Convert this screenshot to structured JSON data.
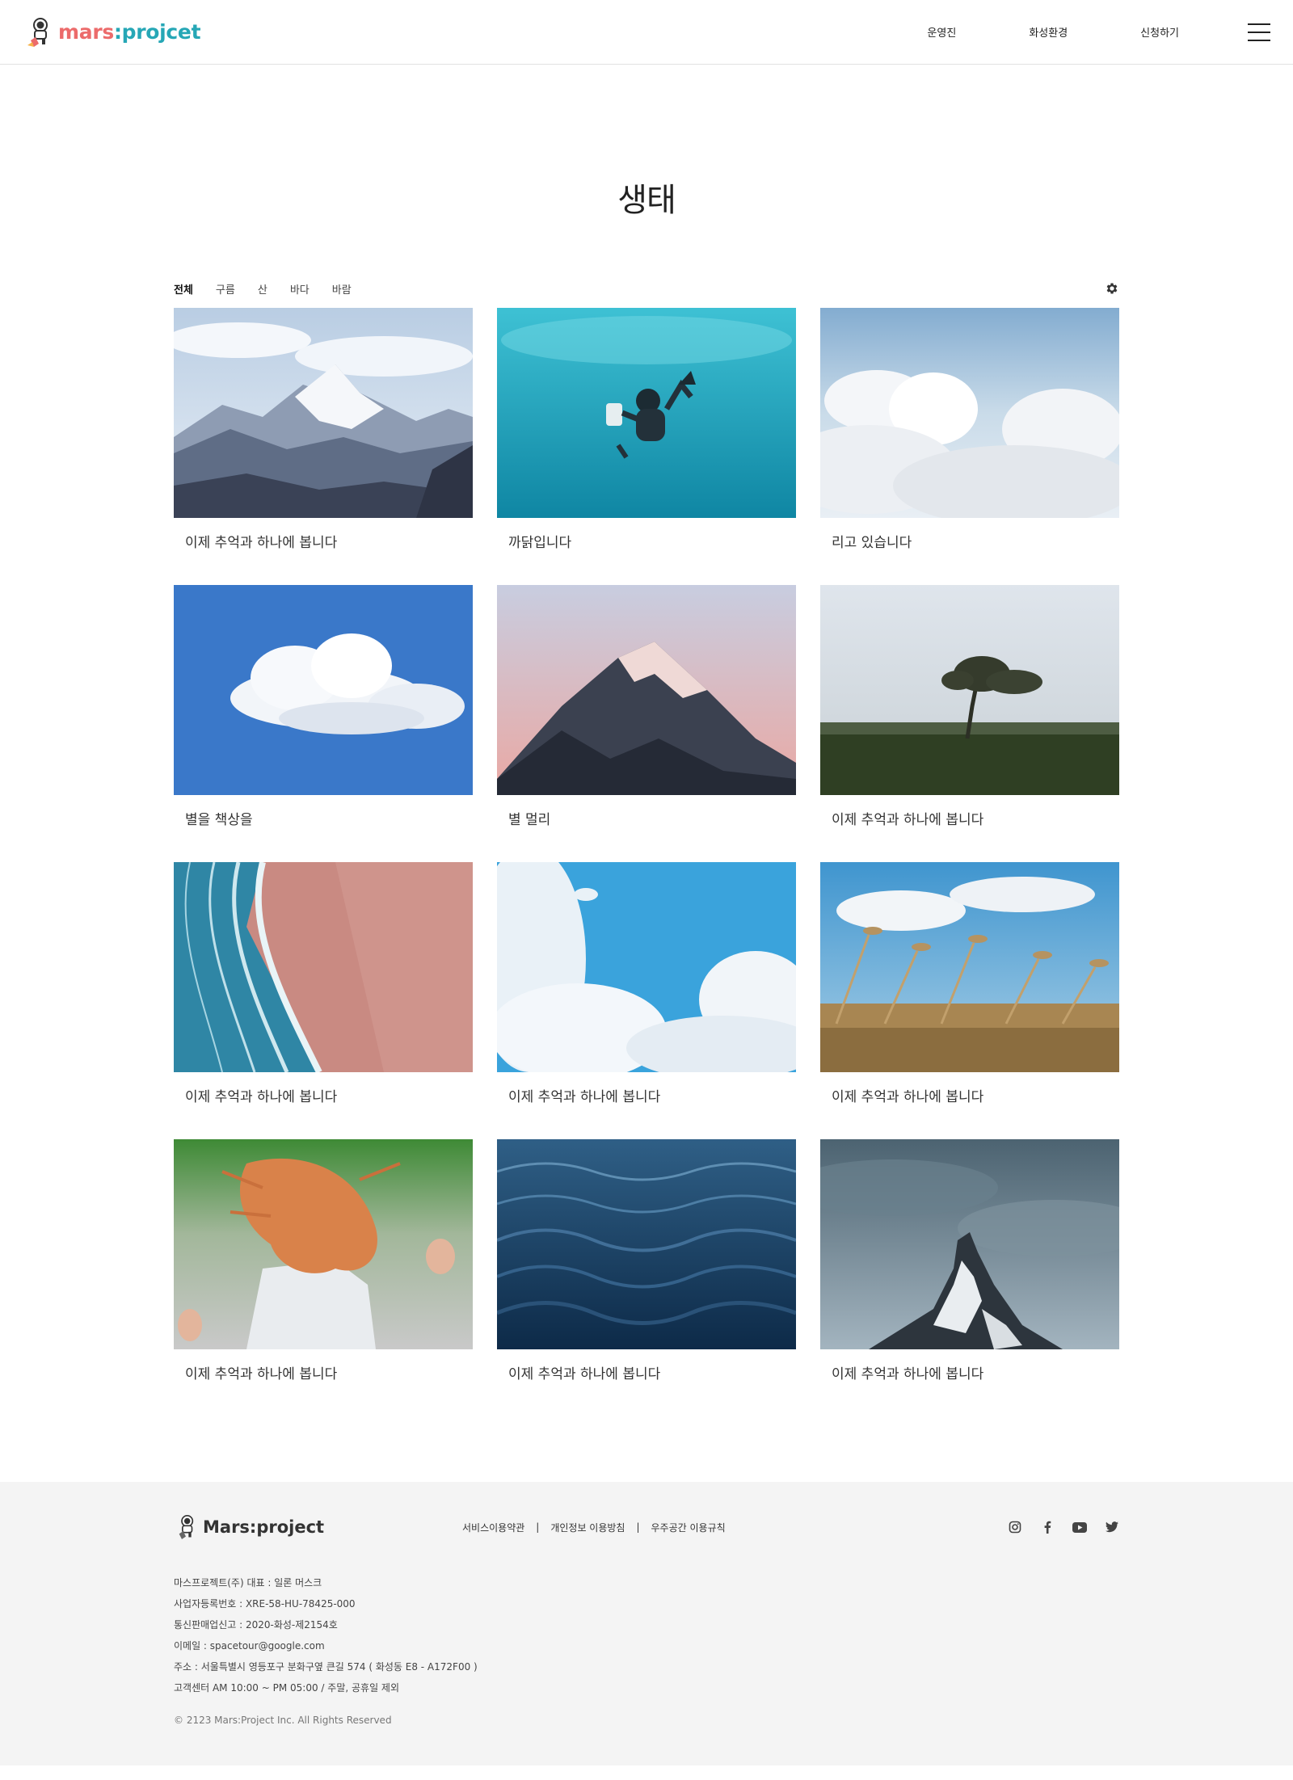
{
  "header": {
    "logo_word1": "mars",
    "logo_word2": ":projcet",
    "nav": [
      "운영진",
      "화성환경",
      "신청하기"
    ]
  },
  "page": {
    "title": "생태",
    "filters": [
      "전체",
      "구름",
      "산",
      "바다",
      "바람"
    ],
    "active_filter": "전체"
  },
  "cards": [
    {
      "image": "snowy-mountain-range",
      "caption": "이제 추억과 하나에 봅니다"
    },
    {
      "image": "underwater-diver",
      "caption": "까닭입니다"
    },
    {
      "image": "cloud-sea",
      "caption": "리고 있습니다"
    },
    {
      "image": "single-cloud-blue-sky",
      "caption": "별을 책상을"
    },
    {
      "image": "mountain-peak-pink-sky",
      "caption": "별 멀리"
    },
    {
      "image": "windswept-tree-fog",
      "caption": "이제 추억과 하나에 봅니다"
    },
    {
      "image": "aerial-beach-waves",
      "caption": "이제 추억과 하나에 봅니다"
    },
    {
      "image": "clouds-blue-sky",
      "caption": "이제 추억과 하나에 봅니다"
    },
    {
      "image": "reeds-in-wind",
      "caption": "이제 추억과 하나에 봅니다"
    },
    {
      "image": "girl-hair-in-wind",
      "caption": "이제 추억과 하나에 봅니다"
    },
    {
      "image": "ocean-waves",
      "caption": "이제 추억과 하나에 봅니다"
    },
    {
      "image": "matterhorn-clouds",
      "caption": "이제 추억과 하나에 봅니다"
    }
  ],
  "footer": {
    "logo_text": "Mars:project",
    "links": [
      "서비스이용약관",
      "개인정보 이용방침",
      "우주공간 이용규칙"
    ],
    "socials": [
      "instagram-icon",
      "facebook-icon",
      "youtube-icon",
      "twitter-icon"
    ],
    "info": [
      "마스프로젝트(주) 대표 : 일론 머스크",
      "사업자등록번호 : XRE-58-HU-78425-000",
      "통신판매업신고 : 2020-화성-제2154호",
      "이메일 : spacetour@google.com",
      "주소 : 서울특별시 영등포구 분화구옆 큰길 574 ( 화성동 E8 - A172F00 )",
      "고객센터 AM 10:00 ~ PM 05:00 / 주말, 공휴일 제외"
    ],
    "copyright": "© 2123 Mars:Project Inc. All Rights Reserved"
  },
  "colors": {
    "logo_red": "#ec6b6b",
    "logo_teal": "#26a7b6",
    "footer_bg": "#f4f4f4"
  }
}
